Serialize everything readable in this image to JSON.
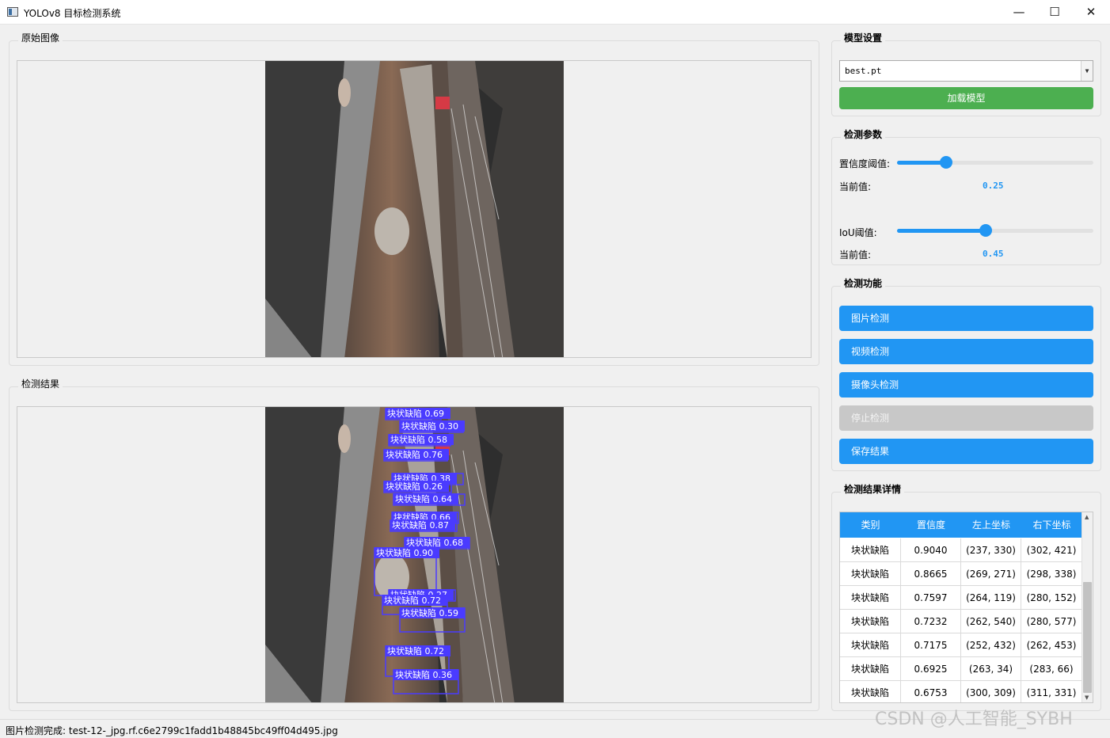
{
  "window": {
    "title": "YOLOv8 目标检测系统",
    "minimize": "—",
    "maximize": "☐",
    "close": "✕"
  },
  "original": {
    "title": "原始图像"
  },
  "result": {
    "title": "检测结果"
  },
  "model": {
    "group_title": "模型设置",
    "selected": "best.pt",
    "load_label": "加载模型"
  },
  "params": {
    "group_title": "检测参数",
    "confidence_label": "置信度阈值:",
    "confidence_value": 0.25,
    "confidence_current_label": "当前值:",
    "confidence_display": "0.25",
    "iou_label": "IoU阈值:",
    "iou_value": 0.45,
    "iou_current_label": "当前值:",
    "iou_display": "0.45"
  },
  "functions": {
    "group_title": "检测功能",
    "image": "图片检测",
    "video": "视频检测",
    "camera": "摄像头检测",
    "stop": "停止检测",
    "save": "保存结果"
  },
  "details": {
    "group_title": "检测结果详情",
    "headers": [
      "类别",
      "置信度",
      "左上坐标",
      "右下坐标"
    ],
    "rows": [
      [
        "块状缺陷",
        "0.9040",
        "(237, 330)",
        "(302, 421)"
      ],
      [
        "块状缺陷",
        "0.8665",
        "(269, 271)",
        "(298, 338)"
      ],
      [
        "块状缺陷",
        "0.7597",
        "(264, 119)",
        "(280, 152)"
      ],
      [
        "块状缺陷",
        "0.7232",
        "(262, 540)",
        "(280, 577)"
      ],
      [
        "块状缺陷",
        "0.7175",
        "(252, 432)",
        "(262, 453)"
      ],
      [
        "块状缺陷",
        "0.6925",
        "(263, 34)",
        "(283, 66)"
      ],
      [
        "块状缺陷",
        "0.6753",
        "(300, 309)",
        "(311, 331)"
      ]
    ]
  },
  "detections": [
    {
      "label": "块状缺陷 0.69"
    },
    {
      "label": "块状缺陷 0.30"
    },
    {
      "label": "块状缺陷 0.58"
    },
    {
      "label": "块状缺陷 0.76"
    },
    {
      "label": "块状缺陷 0.38"
    },
    {
      "label": "块状缺陷 0.26"
    },
    {
      "label": "块状缺陷 0.64"
    },
    {
      "label": "块状缺陷 0.66"
    },
    {
      "label": "块状缺陷 0.87"
    },
    {
      "label": "块状缺陷 0.68"
    },
    {
      "label": "块状缺陷 0.90"
    },
    {
      "label": "块状缺陷 0.27"
    },
    {
      "label": "块状缺陷 0.72"
    },
    {
      "label": "块状缺陷 0.59"
    },
    {
      "label": "块状缺陷 0.72"
    },
    {
      "label": "块状缺陷 0.36"
    }
  ],
  "status": "图片检测完成: test-12-_jpg.rf.c6e2799c1fadd1b48845bc49ff04d495.jpg",
  "watermark": "CSDN @人工智能_SYBH",
  "colors": {
    "accent": "#2196f3",
    "load": "#4caf50",
    "disabled": "#c8c8c8",
    "box": "#4a3bff"
  }
}
